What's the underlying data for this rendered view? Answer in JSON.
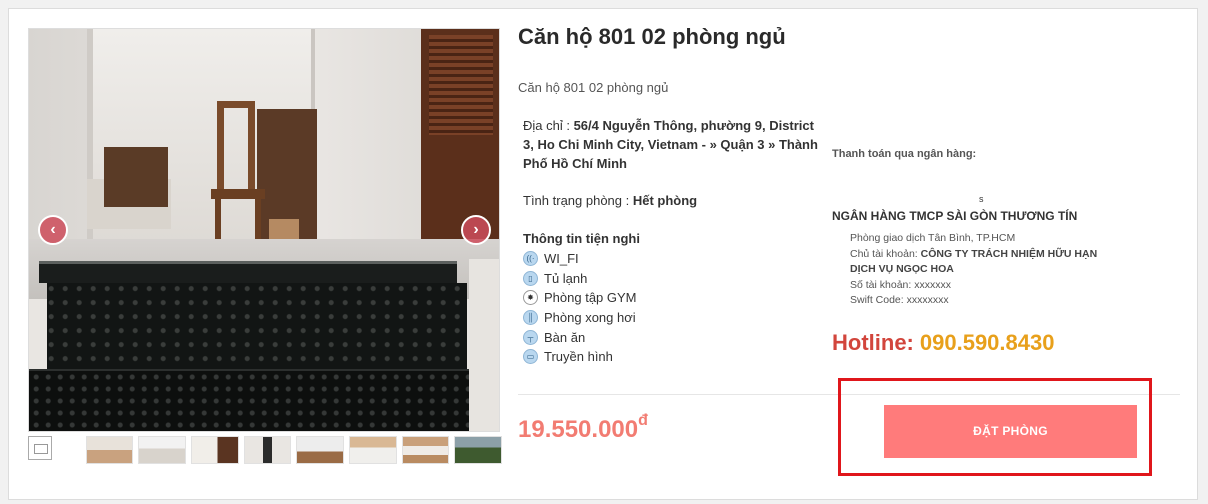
{
  "listing": {
    "title": "Căn hộ 801 02 phòng ngủ",
    "subtitle": "Căn hộ 801 02 phòng ngủ",
    "address_label": "Địa chỉ : ",
    "address_value": "56/4 Nguyễn Thông, phường 9, District 3, Ho Chi Minh City, Vietnam - » Quận 3 » Thành Phố Hồ Chí Minh",
    "status_label": "Tình trạng phòng : ",
    "status_value": "Hết phòng",
    "amenities_title": "Thông tin tiện nghi",
    "amenities": [
      {
        "label": "WI_FI",
        "icon": "wifi-icon"
      },
      {
        "label": "Tủ lạnh",
        "icon": "fridge-icon"
      },
      {
        "label": "Phòng tập GYM",
        "icon": "gym-icon"
      },
      {
        "label": "Phòng xong hơi",
        "icon": "sauna-icon"
      },
      {
        "label": "Bàn ăn",
        "icon": "dining-table-icon"
      },
      {
        "label": "Truyền hình",
        "icon": "tv-icon"
      }
    ],
    "price": "19.550.000",
    "currency": "đ"
  },
  "bank": {
    "payment_label": "Thanh toán qua ngân hàng:",
    "logo_alt": "s",
    "name": "NGÂN HÀNG TMCP SÀI GÒN THƯƠNG TÍN",
    "branch": "Phòng giao dịch Tân Bình, TP.HCM",
    "owner_label": "Chủ tài khoản: ",
    "owner_value": "CÔNG TY TRÁCH NHIỆM HỮU HẠN DỊCH VỤ NGỌC HOA",
    "account_no": "Số tài khoản: xxxxxxx",
    "swift": "Swift Code: xxxxxxxx"
  },
  "hotline": {
    "label": "Hotline:",
    "number": "090.590.8430"
  },
  "actions": {
    "book_label": "ĐẶT PHÒNG",
    "prev_arrow": "‹",
    "next_arrow": "›"
  },
  "colors": {
    "accent_red": "#d2453c",
    "hotline_orange": "#e8a01b",
    "price_coral": "#f27c72",
    "button_bg": "#ff7b7b",
    "highlight_border": "#e0161b"
  },
  "gallery": {
    "thumb_count": 9
  }
}
